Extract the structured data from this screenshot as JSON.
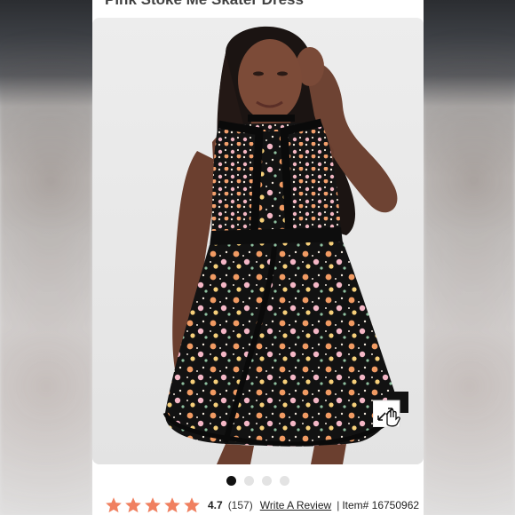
{
  "product": {
    "title_peek": "Pink Stoke Me Skater Dress",
    "image_alt": "Model wearing black floral halter skater dress"
  },
  "carousel": {
    "dots": [
      {
        "active": true
      },
      {
        "active": false
      },
      {
        "active": false
      },
      {
        "active": false
      }
    ]
  },
  "reviews": {
    "rating": "4.7",
    "count": "(157)",
    "write_review": "Write A Review",
    "separator": "|",
    "item_number": "Item# 16750962",
    "star_color": "#f08060",
    "stars_filled": 5
  },
  "icons": {
    "zoom": "expand-zoom-icon",
    "star": "star-icon"
  },
  "colors": {
    "accent_star": "#f08060",
    "dot_active": "#111111",
    "dot_inactive": "#e3e3e3"
  }
}
